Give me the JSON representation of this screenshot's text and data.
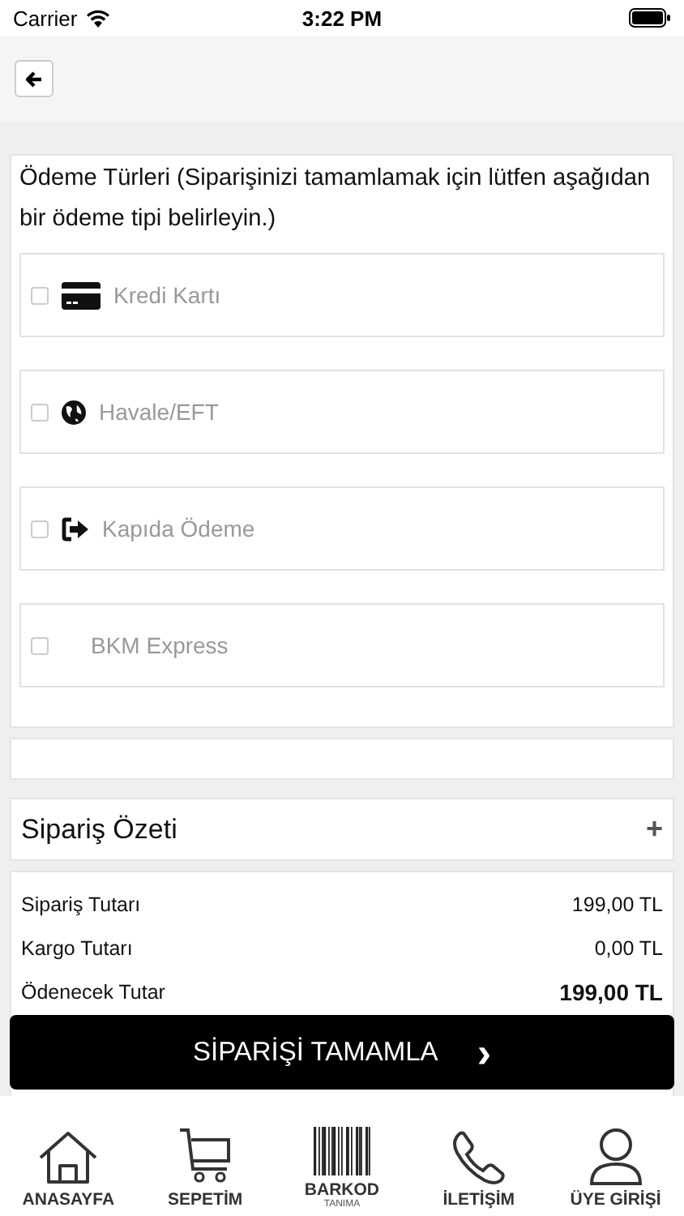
{
  "status_bar": {
    "carrier": "Carrier",
    "time": "3:22 PM"
  },
  "payment": {
    "title": "Ödeme Türleri (Siparişinizi tamamlamak için lütfen aşağıdan bir ödeme tipi belirleyin.)",
    "options": [
      {
        "label": "Kredi Kartı",
        "kind": "card",
        "checked": false
      },
      {
        "label": "Havale/EFT",
        "kind": "globe",
        "checked": false
      },
      {
        "label": "Kapıda Ödeme",
        "kind": "exit",
        "checked": false
      },
      {
        "label": "BKM Express",
        "kind": "none",
        "checked": false
      }
    ]
  },
  "summary": {
    "title": "Sipariş Özeti",
    "expand": "+",
    "rows": [
      {
        "label": "Sipariş Tutarı",
        "value": "199,00 TL",
        "bold": false
      },
      {
        "label": "Kargo Tutarı",
        "value": "0,00 TL",
        "bold": false
      },
      {
        "label": "Ödenecek Tutar",
        "value": "199,00 TL",
        "bold": true
      }
    ]
  },
  "complete_button": {
    "label": "SİPARİŞİ TAMAMLA",
    "arrow": "›"
  },
  "nav": [
    {
      "label": "ANASAYFA",
      "kind": "home"
    },
    {
      "label": "SEPETİM",
      "kind": "cart"
    },
    {
      "label": "BARKOD",
      "sub": "TANIMA",
      "kind": "barcode"
    },
    {
      "label": "İLETİŞİM",
      "kind": "phone"
    },
    {
      "label": "ÜYE GİRİŞİ",
      "kind": "user"
    }
  ]
}
